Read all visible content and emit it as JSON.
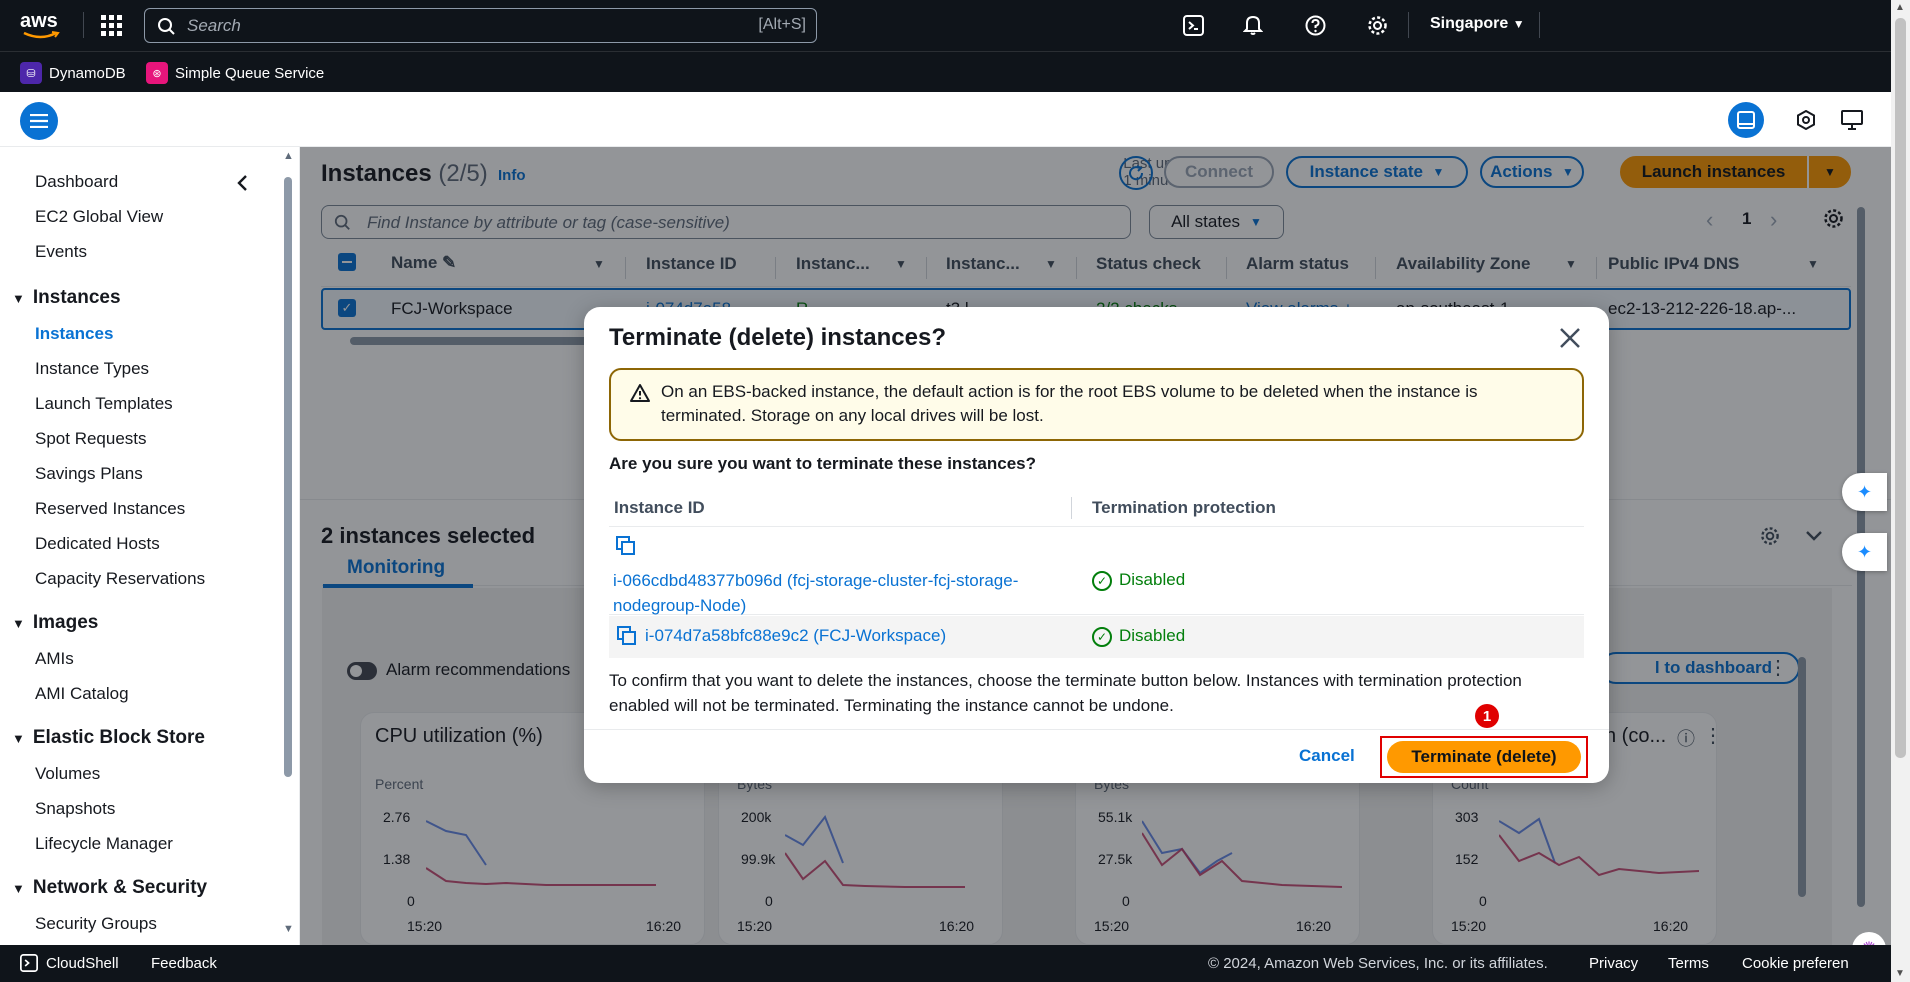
{
  "topnav": {
    "logo": "aws",
    "search_placeholder": "Search",
    "search_shortcut": "[Alt+S]",
    "region": "Singapore"
  },
  "services": [
    {
      "label": "DynamoDB",
      "color": "#4d27aa"
    },
    {
      "label": "Simple Queue Service",
      "color": "#e7157b"
    }
  ],
  "sidebar": {
    "top_items": [
      "Dashboard",
      "EC2 Global View",
      "Events"
    ],
    "groups": [
      {
        "title": "Instances",
        "items": [
          "Instances",
          "Instance Types",
          "Launch Templates",
          "Spot Requests",
          "Savings Plans",
          "Reserved Instances",
          "Dedicated Hosts",
          "Capacity Reservations"
        ]
      },
      {
        "title": "Images",
        "items": [
          "AMIs",
          "AMI Catalog"
        ]
      },
      {
        "title": "Elastic Block Store",
        "items": [
          "Volumes",
          "Snapshots",
          "Lifecycle Manager"
        ]
      },
      {
        "title": "Network & Security",
        "items": [
          "Security Groups"
        ]
      }
    ],
    "active": "Instances"
  },
  "main": {
    "title": "Instances",
    "count": "(2/5)",
    "info": "Info",
    "last_updated_1": "Last updated",
    "last_updated_2": "1 minute ago",
    "connect": "Connect",
    "instance_state": "Instance state",
    "actions": "Actions",
    "launch": "Launch instances",
    "find_placeholder": "Find Instance by attribute or tag (case-sensitive)",
    "all_states": "All states",
    "page": "1",
    "columns": [
      "Name",
      "Instance ID",
      "Instanc...",
      "Instanc...",
      "Status check",
      "Alarm status",
      "Availability Zone",
      "Public IPv4 DNS"
    ],
    "row_name": "FCJ-Workspace",
    "row_dns": "ec2-13-212-226-18.ap-...",
    "row_partial": [
      "i-074d7a58...",
      "R...",
      "t3.l...",
      "2/2 checks...",
      "View alarms +",
      "ap-southeast-1..."
    ],
    "selected_title": "2 instances selected",
    "tab_monitoring": "Monitoring",
    "alarm_rec": "Alarm recommendations",
    "add_dashboard": "l to dashboard",
    "charts": [
      {
        "title": "CPU utilization (%)",
        "unit": "Percent",
        "ticks": [
          "2.76",
          "1.38",
          "0"
        ],
        "x": [
          "15:20",
          "16:20"
        ]
      },
      {
        "title": "",
        "unit": "Bytes",
        "ticks": [
          "200k",
          "99.9k",
          "0"
        ],
        "x": [
          "15:20",
          "16:20"
        ]
      },
      {
        "title": "",
        "unit": "Bytes",
        "ticks": [
          "55.1k",
          "27.5k",
          "0"
        ],
        "x": [
          "15:20",
          "16:20"
        ]
      },
      {
        "title": "s in (co...",
        "unit": "Count",
        "ticks": [
          "303",
          "152",
          "0"
        ],
        "x": [
          "15:20",
          "16:20"
        ]
      }
    ]
  },
  "modal": {
    "title": "Terminate (delete) instances?",
    "warning": "On an EBS-backed instance, the default action is for the root EBS volume to be deleted when the instance is terminated. Storage on any local drives will be lost.",
    "question": "Are you sure you want to terminate these instances?",
    "col_id": "Instance ID",
    "col_protection": "Termination protection",
    "rows": [
      {
        "id": "i-066cdbd48377b096d (fcj-storage-cluster-fcj-storage-nodegroup-Node)",
        "protection": "Disabled"
      },
      {
        "id": "i-074d7a58bfc88e9c2 (FCJ-Workspace)",
        "protection": "Disabled"
      }
    ],
    "confirm_text": "To confirm that you want to delete the instances, choose the terminate button below. Instances with termination protection enabled will not be terminated. Terminating the instance cannot be undone.",
    "cancel": "Cancel",
    "terminate": "Terminate (delete)",
    "step_badge": "1"
  },
  "footer": {
    "cloudshell": "CloudShell",
    "feedback": "Feedback",
    "copyright": "© 2024, Amazon Web Services, Inc. or its affiliates.",
    "privacy": "Privacy",
    "terms": "Terms",
    "cookie": "Cookie preferen"
  }
}
